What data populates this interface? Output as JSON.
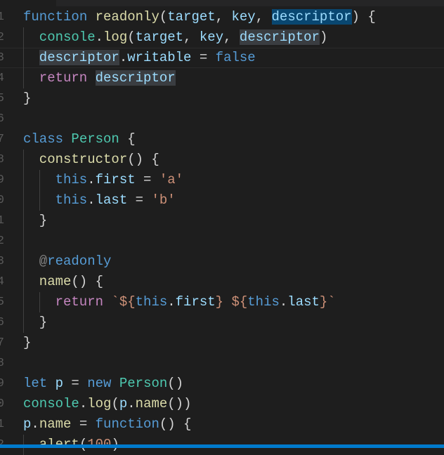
{
  "editor": {
    "language": "javascript",
    "current_line": 3,
    "colors": {
      "statusbar": "#007acc",
      "background": "#1e1e1e",
      "selection": "#094771"
    },
    "lines": [
      {
        "indent": 0,
        "tokens": [
          [
            "function",
            "kw"
          ],
          [
            " ",
            "pu"
          ],
          [
            "readonly",
            "fn"
          ],
          [
            "(",
            "pu"
          ],
          [
            "target",
            "pa"
          ],
          [
            ", ",
            "pu"
          ],
          [
            "key",
            "pa"
          ],
          [
            ", ",
            "pu"
          ],
          [
            "descriptor",
            "pa hl-sel"
          ],
          [
            ") {",
            "pu"
          ]
        ]
      },
      {
        "indent": 1,
        "tokens": [
          [
            "console",
            "cl"
          ],
          [
            ".",
            "pu"
          ],
          [
            "log",
            "fn"
          ],
          [
            "(",
            "pu"
          ],
          [
            "target",
            "pa"
          ],
          [
            ", ",
            "pu"
          ],
          [
            "key",
            "pa"
          ],
          [
            ", ",
            "pu"
          ],
          [
            "descriptor",
            "pa hl-occ"
          ],
          [
            ")",
            "pu"
          ]
        ]
      },
      {
        "indent": 1,
        "tokens": [
          [
            "descri",
            "pa hl-occ"
          ],
          [
            "|cursor|",
            "cursor"
          ],
          [
            "ptor",
            "pa hl-occ"
          ],
          [
            ".",
            "pu"
          ],
          [
            "writable",
            "pa"
          ],
          [
            " = ",
            "pu"
          ],
          [
            "false",
            "kw"
          ]
        ]
      },
      {
        "indent": 1,
        "tokens": [
          [
            "return",
            "ctl"
          ],
          [
            " ",
            "pu"
          ],
          [
            "descriptor",
            "pa hl-occ"
          ]
        ]
      },
      {
        "indent": 0,
        "tokens": [
          [
            "}",
            "pu"
          ]
        ]
      },
      {
        "indent": 0,
        "tokens": []
      },
      {
        "indent": 0,
        "tokens": [
          [
            "class",
            "kw"
          ],
          [
            " ",
            "pu"
          ],
          [
            "Person",
            "cl"
          ],
          [
            " {",
            "pu"
          ]
        ]
      },
      {
        "indent": 1,
        "tokens": [
          [
            "constructor",
            "fn"
          ],
          [
            "() {",
            "pu"
          ]
        ]
      },
      {
        "indent": 2,
        "tokens": [
          [
            "this",
            "kw"
          ],
          [
            ".",
            "pu"
          ],
          [
            "first",
            "pa"
          ],
          [
            " = ",
            "pu"
          ],
          [
            "'a'",
            "st"
          ]
        ]
      },
      {
        "indent": 2,
        "tokens": [
          [
            "this",
            "kw"
          ],
          [
            ".",
            "pu"
          ],
          [
            "last",
            "pa"
          ],
          [
            " = ",
            "pu"
          ],
          [
            "'b'",
            "st"
          ]
        ]
      },
      {
        "indent": 1,
        "tokens": [
          [
            "}",
            "pu"
          ]
        ]
      },
      {
        "indent": 1,
        "guide_only": true,
        "tokens": []
      },
      {
        "indent": 1,
        "tokens": [
          [
            "@",
            "dec"
          ],
          [
            "readonly",
            "kw"
          ]
        ]
      },
      {
        "indent": 1,
        "tokens": [
          [
            "name",
            "fn"
          ],
          [
            "() {",
            "pu"
          ]
        ]
      },
      {
        "indent": 2,
        "tokens": [
          [
            "return",
            "ctl"
          ],
          [
            " ",
            "pu"
          ],
          [
            "`${",
            "st"
          ],
          [
            "this",
            "kw"
          ],
          [
            ".",
            "pu"
          ],
          [
            "first",
            "pa"
          ],
          [
            "} ${",
            "st"
          ],
          [
            "this",
            "kw"
          ],
          [
            ".",
            "pu"
          ],
          [
            "last",
            "pa"
          ],
          [
            "}`",
            "st"
          ]
        ]
      },
      {
        "indent": 1,
        "tokens": [
          [
            "}",
            "pu"
          ]
        ]
      },
      {
        "indent": 0,
        "tokens": [
          [
            "}",
            "pu"
          ]
        ]
      },
      {
        "indent": 0,
        "tokens": []
      },
      {
        "indent": 0,
        "tokens": [
          [
            "let",
            "kw"
          ],
          [
            " ",
            "pu"
          ],
          [
            "p",
            "pa"
          ],
          [
            " = ",
            "pu"
          ],
          [
            "new",
            "kw"
          ],
          [
            " ",
            "pu"
          ],
          [
            "Person",
            "cl"
          ],
          [
            "()",
            "pu"
          ]
        ]
      },
      {
        "indent": 0,
        "tokens": [
          [
            "console",
            "cl"
          ],
          [
            ".",
            "pu"
          ],
          [
            "log",
            "fn"
          ],
          [
            "(",
            "pu"
          ],
          [
            "p",
            "pa"
          ],
          [
            ".",
            "pu"
          ],
          [
            "name",
            "fn"
          ],
          [
            "())",
            "pu"
          ]
        ]
      },
      {
        "indent": 0,
        "tokens": [
          [
            "p",
            "pa"
          ],
          [
            ".",
            "pu"
          ],
          [
            "name",
            "fn"
          ],
          [
            " = ",
            "pu"
          ],
          [
            "function",
            "kw"
          ],
          [
            "() {",
            "pu"
          ]
        ]
      },
      {
        "indent": 1,
        "tokens": [
          [
            "alert",
            "fn"
          ],
          [
            "(",
            "pu"
          ],
          [
            "100",
            "st"
          ],
          [
            ")",
            "pu"
          ]
        ]
      }
    ]
  }
}
